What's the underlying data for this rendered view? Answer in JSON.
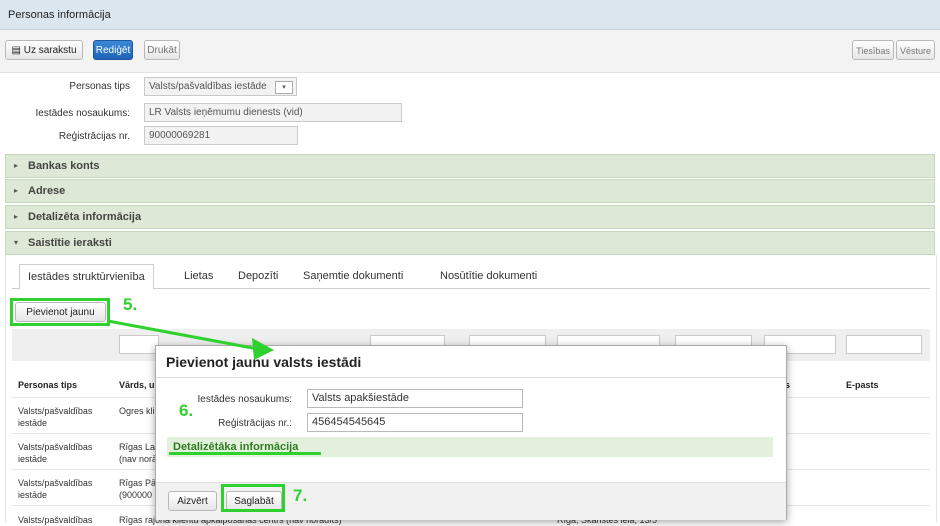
{
  "window": {
    "title": "Personas informācija"
  },
  "toolbar": {
    "back_label": "Uz sarakstu",
    "edit_label": "Rediģēt",
    "print_label": "Drukāt",
    "rights_label": "Tiesības",
    "history_label": "Vēsture"
  },
  "form": {
    "person_type_label": "Personas tips",
    "person_type_value": "Valsts/pašvaldības iestāde",
    "name_label": "Iestādes nosaukums:",
    "name_value": "LR Valsts ieņēmumu dienests (vid)",
    "reg_label": "Reģistrācijas nr.",
    "reg_value": "90000069281"
  },
  "sections": {
    "bank": "Bankas konts",
    "address": "Adrese",
    "details": "Detalizēta informācija",
    "related": "Saistītie ieraksti"
  },
  "tabs": [
    {
      "label": "Iestādes struktūrvienība"
    },
    {
      "label": "Lietas"
    },
    {
      "label": "Depozīti"
    },
    {
      "label": "Saņemtie dokumenti"
    },
    {
      "label": "Nosūtītie dokumenti"
    }
  ],
  "add_new_label": "Pievienot jaunu",
  "table": {
    "headers": {
      "type": "Personas tips",
      "name": "Vārds, u",
      "col_s": "s",
      "email": "E-pasts"
    },
    "rows": [
      {
        "type": "Valsts/pašvaldības iestāde",
        "name": "Ogres kli"
      },
      {
        "type": "Valsts/pašvaldības iestāde",
        "name": "Rīgas Lat (nav norā"
      },
      {
        "type": "Valsts/pašvaldības iestāde",
        "name": "Rīgas Pā (900000"
      },
      {
        "type": "Valsts/pašvaldības",
        "name": "Rīgas rajona klientu apkalpošanas centrs (nav norādīts)",
        "address": "Rīga, Skanstes iela, 13/5"
      }
    ]
  },
  "modal": {
    "title": "Pievienot jaunu valsts iestādi",
    "name_label": "Iestādes nosaukums:",
    "name_value": "Valsts apakšiestāde",
    "reg_label": "Reģistrācijas nr.:",
    "reg_value": "456454545645",
    "details_link": "Detalizētāka informācija",
    "close_label": "Aizvērt",
    "save_label": "Saglabāt"
  },
  "annotations": {
    "step5": "5.",
    "step6": "6.",
    "step7": "7."
  },
  "colors": {
    "highlight": "#2fd12f",
    "primary": "#1f63b5",
    "section": "#dde9d6"
  },
  "icons": {
    "back": "list-icon",
    "dropdown": "chevron-down-icon",
    "expand": "triangle-right-icon",
    "collapse": "triangle-down-icon"
  }
}
